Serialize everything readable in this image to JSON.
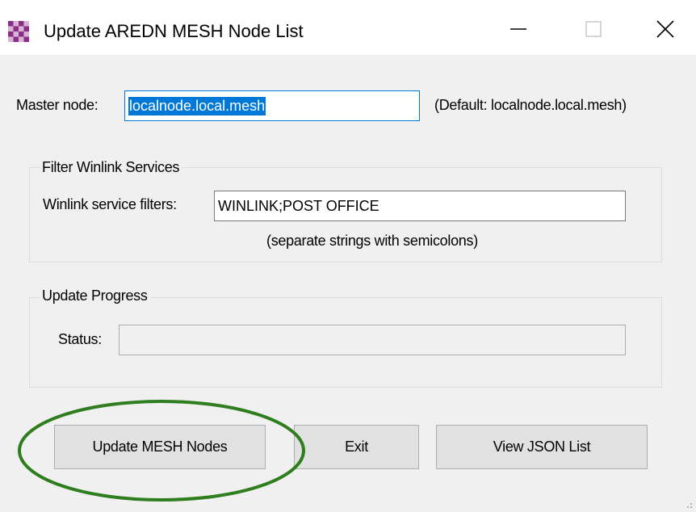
{
  "window": {
    "title": "Update AREDN MESH Node List",
    "icons": {
      "app": "checkerboard-app-icon",
      "minimize": "minimize-icon",
      "maximize": "maximize-icon",
      "close": "close-icon"
    }
  },
  "master": {
    "label": "Master node:",
    "value": "localnode.local.mesh",
    "default_hint": "(Default: localnode.local.mesh)"
  },
  "filter_group": {
    "title": "Filter Winlink Services",
    "label": "Winlink service filters:",
    "value": "WINLINK;POST OFFICE",
    "hint": "(separate strings with semicolons)"
  },
  "progress_group": {
    "title": "Update Progress",
    "status_label": "Status:",
    "status_value": ""
  },
  "buttons": {
    "update": "Update MESH Nodes",
    "exit": "Exit",
    "view_json": "View JSON List"
  },
  "colors": {
    "selection": "#0078d7",
    "annotation_circle": "#2e7d1e",
    "app_icon_primary": "#8b2f86"
  }
}
